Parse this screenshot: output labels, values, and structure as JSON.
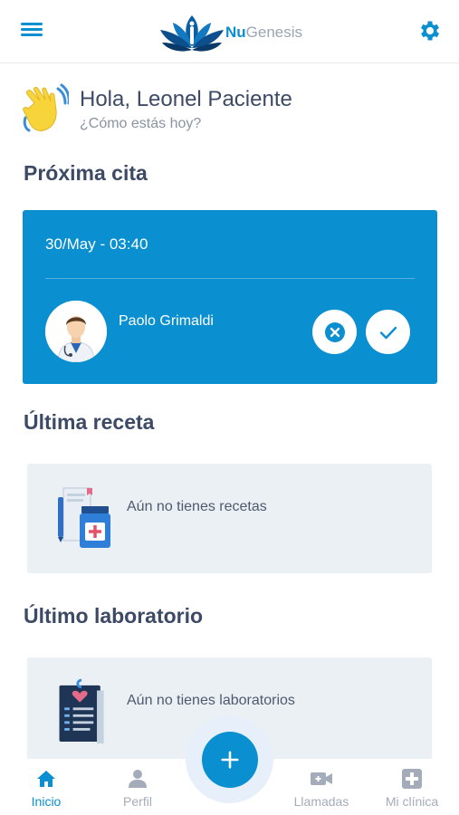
{
  "header": {
    "brand_nu": "Nu",
    "brand_genesis": "Genesis",
    "menu_icon": "hamburger-icon",
    "settings_icon": "gear-icon"
  },
  "greeting": {
    "title": "Hola, Leonel Paciente",
    "subtitle": "¿Cómo estás hoy?"
  },
  "next_appointment": {
    "section_title": "Próxima cita",
    "date_time": "30/May - 03:40",
    "doctor_name": "Paolo Grimaldi",
    "cancel_icon": "cancel-icon",
    "confirm_icon": "check-icon"
  },
  "last_prescription": {
    "section_title": "Última receta",
    "empty_text": "Aún no tienes recetas"
  },
  "last_lab": {
    "section_title": "Último laboratorio",
    "empty_text": "Aún no tienes laboratorios"
  },
  "fab": {
    "icon": "plus-icon"
  },
  "bottom_nav": {
    "items": [
      {
        "label": "Inicio",
        "icon": "home-icon",
        "active": true
      },
      {
        "label": "Perfil",
        "icon": "user-icon",
        "active": false
      },
      {
        "label": "Llamadas",
        "icon": "video-camera-icon",
        "active": false
      },
      {
        "label": "Mi clínica",
        "icon": "medical-cross-icon",
        "active": false
      }
    ]
  },
  "colors": {
    "primary": "#0a8fd1",
    "text_dark": "#3d4a66",
    "card_bg": "#ebf0f4",
    "nav_inactive": "#a3acb8"
  }
}
